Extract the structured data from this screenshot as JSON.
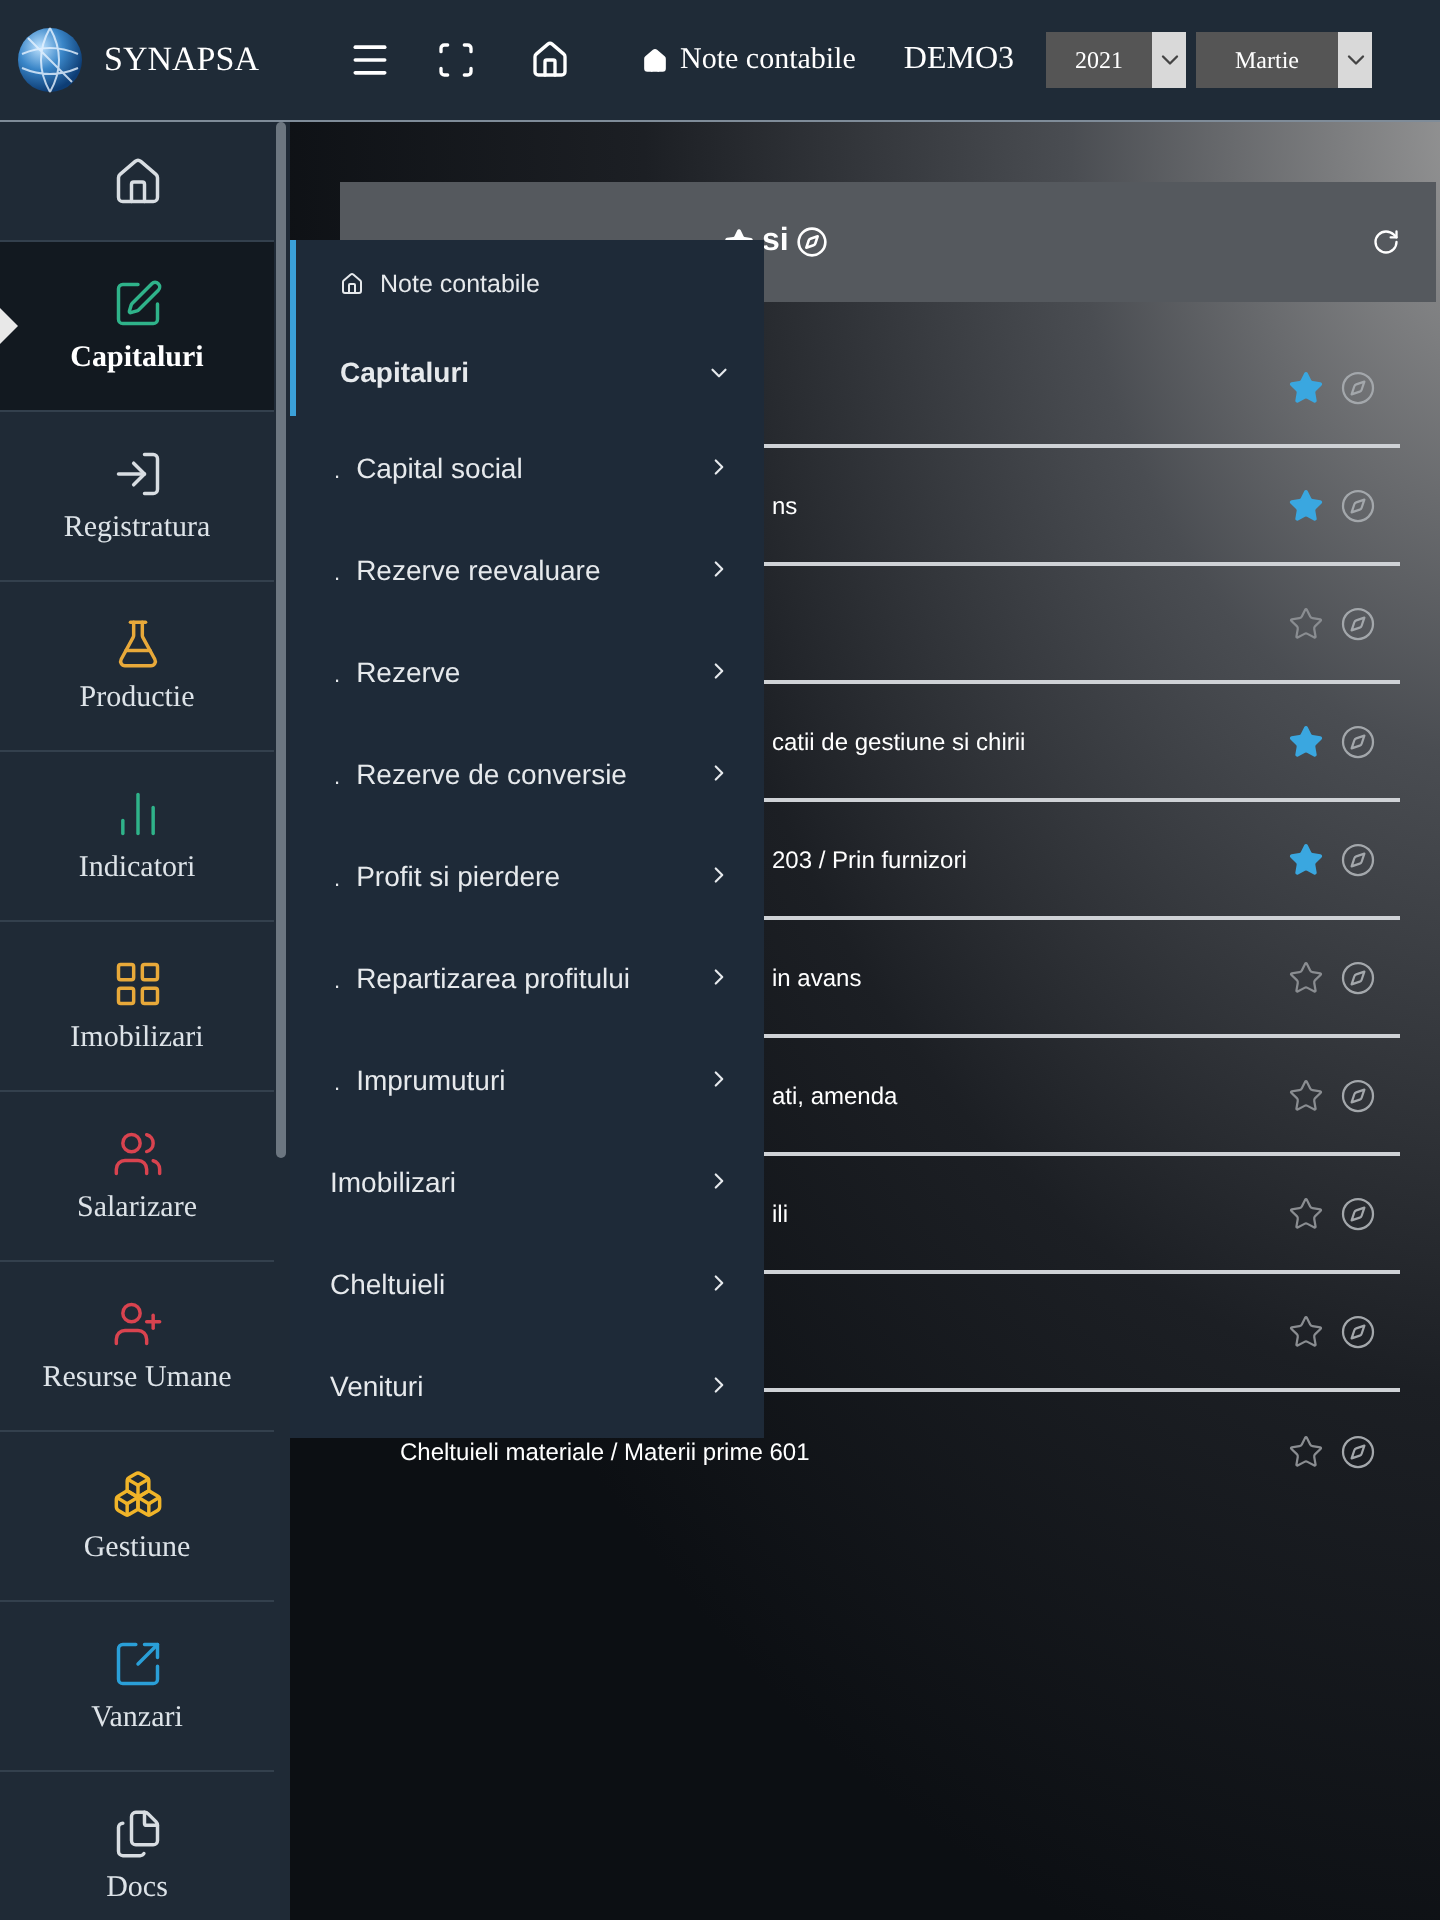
{
  "topbar": {
    "brand": "SYNAPSA",
    "breadcrumb": "Note contabile",
    "company": "DEMO3",
    "year": "2021",
    "month": "Martie"
  },
  "sidebar": {
    "items": [
      {
        "color": "#d8dde2",
        "selected": false
      },
      {
        "label": "Capitaluri",
        "color": "#2fb38a",
        "selected": true
      },
      {
        "label": "Registratura",
        "color": "#d8dde2",
        "selected": false
      },
      {
        "label": "Productie",
        "color": "#e8a93a",
        "selected": false
      },
      {
        "label": "Indicatori",
        "color": "#2fb38a",
        "selected": false
      },
      {
        "label": "Imobilizari",
        "color": "#e8a93a",
        "selected": false
      },
      {
        "label": "Salarizare",
        "color": "#d9434f",
        "selected": false
      },
      {
        "label": "Resurse Umane",
        "color": "#d9434f",
        "selected": false
      },
      {
        "label": "Gestiune",
        "color": "#f0b429",
        "selected": false
      },
      {
        "label": "Vanzari",
        "color": "#2a9fd8",
        "selected": false
      },
      {
        "label": "Docs",
        "color": "#d8dde2",
        "selected": false
      }
    ]
  },
  "panel": {
    "title": "si"
  },
  "rows": [
    {
      "starred": true
    },
    {
      "text": "ns",
      "starred": true
    },
    {
      "starred": false
    },
    {
      "text": "catii de gestiune si chirii",
      "starred": true
    },
    {
      "text": "203 / Prin furnizori",
      "starred": true
    },
    {
      "text": "in avans",
      "starred": false
    },
    {
      "text": "ati, amenda",
      "starred": false
    },
    {
      "text": "ili",
      "starred": false
    },
    {
      "starred": false
    },
    {
      "text": "Cheltuieli materiale / Materii prime 601",
      "starred": false,
      "kind": "full"
    }
  ],
  "menu": {
    "title": "Note contabile",
    "items": [
      {
        "label": "Capitaluri",
        "expanded": true,
        "children": [
          {
            "marker": ".",
            "label": "Capital social"
          },
          {
            "marker": ".",
            "label": "Rezerve reevaluare"
          },
          {
            "marker": ".",
            "label": "Rezerve"
          },
          {
            "marker": ".",
            "label": "Rezerve de conversie"
          },
          {
            "marker": ".",
            "label": "Profit si pierdere"
          },
          {
            "marker": ".",
            "label": "Repartizarea profitului"
          },
          {
            "marker": ".",
            "label": "Imprumuturi"
          }
        ]
      },
      {
        "label": "Imobilizari",
        "expanded": false
      },
      {
        "label": "Cheltuieli",
        "expanded": false
      },
      {
        "label": "Venituri",
        "expanded": false
      }
    ]
  }
}
